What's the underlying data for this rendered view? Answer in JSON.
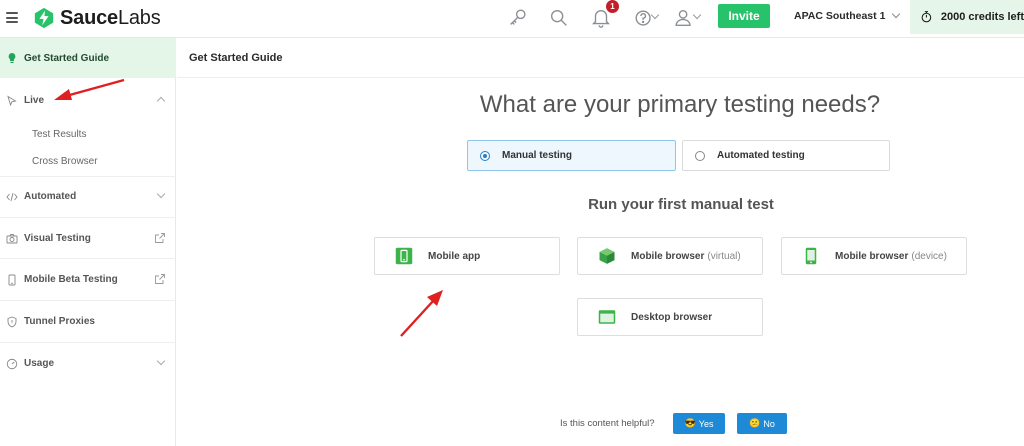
{
  "topbar": {
    "logo": {
      "brand_bold": "Sauce",
      "brand_light": "Labs"
    },
    "notification_count": "1",
    "invite_label": "Invite",
    "region_label": "APAC Southeast 1",
    "credits_label": "2000 credits left",
    "icons": [
      "menu-icon",
      "key-icon",
      "search-icon",
      "bell-icon",
      "help-icon",
      "user-icon",
      "stopwatch-icon"
    ]
  },
  "sidebar": {
    "active": {
      "label": "Get Started Guide",
      "icon": "lightbulb-icon"
    },
    "items": [
      {
        "label": "Live",
        "icon": "cursor-icon",
        "expanded": true
      },
      {
        "label": "Automated",
        "icon": "code-icon",
        "expanded": false
      },
      {
        "label": "Visual Testing",
        "icon": "camera-icon",
        "external": true
      },
      {
        "label": "Mobile Beta Testing",
        "icon": "phone-icon",
        "external": true
      },
      {
        "label": "Tunnel Proxies",
        "icon": "shield-icon"
      },
      {
        "label": "Usage",
        "icon": "gauge-icon",
        "expanded": false
      }
    ],
    "live_subitems": [
      "Test Results",
      "Cross Browser"
    ]
  },
  "main": {
    "page_title": "Get Started Guide",
    "headline": "What are your primary testing needs?",
    "options": [
      {
        "label": "Manual testing",
        "selected": true
      },
      {
        "label": "Automated testing",
        "selected": false
      }
    ],
    "subhead": "Run your first manual test",
    "cards": [
      {
        "label": "Mobile app",
        "sub": "",
        "icon": "mobile-app-icon"
      },
      {
        "label": "Mobile browser",
        "sub": "(virtual)",
        "icon": "cube-icon"
      },
      {
        "label": "Mobile browser",
        "sub": "(device)",
        "icon": "phone-device-icon"
      },
      {
        "label": "Desktop browser",
        "sub": "",
        "icon": "browser-window-icon"
      }
    ],
    "feedback": {
      "question": "Is this content helpful?",
      "yes_label": "Yes",
      "no_label": "No"
    }
  },
  "colors": {
    "brand_green": "#27c36a",
    "active_bg": "#e3f6e8",
    "selected_bg": "#eef7fd",
    "feedback_blue": "#1e8ad7",
    "annotation_red": "#e02020"
  }
}
